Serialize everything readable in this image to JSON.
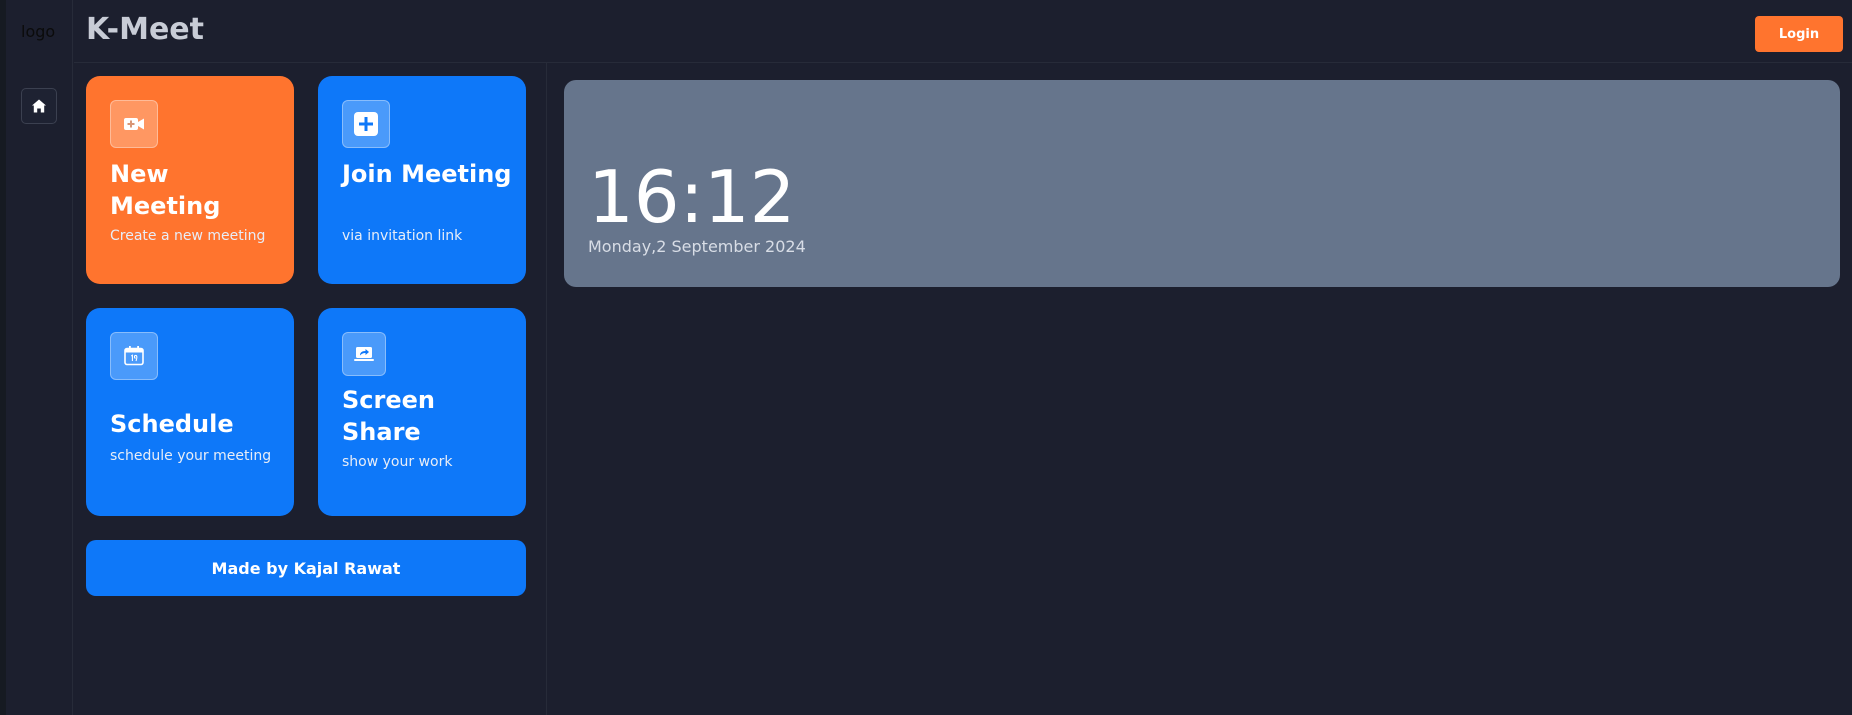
{
  "sidebar": {
    "logo_text": "logo",
    "home_icon": "home-icon"
  },
  "header": {
    "title": "K-Meet",
    "login_label": "Login"
  },
  "cards": [
    {
      "title": "New Meeting",
      "subtitle": "Create a new meeting",
      "icon": "video-plus-icon",
      "color": "#ff742e"
    },
    {
      "title": "Join Meeting",
      "subtitle": "via invitation link",
      "icon": "plus-square-icon",
      "color": "#0e78f9"
    },
    {
      "title": "Schedule",
      "subtitle": "schedule your meeting",
      "icon": "calendar-icon",
      "color": "#0e78f9"
    },
    {
      "title": "Screen Share",
      "subtitle": "show your work",
      "icon": "screen-share-icon",
      "color": "#0e78f9"
    }
  ],
  "footer_button": {
    "label": "Made by Kajal Rawat"
  },
  "clock": {
    "time": "16:12",
    "date": "Monday,2 September 2024"
  },
  "colors": {
    "background": "#1c1f2e",
    "accent_orange": "#ff742e",
    "accent_blue": "#0e78f9",
    "clock_card": "#66758c"
  }
}
